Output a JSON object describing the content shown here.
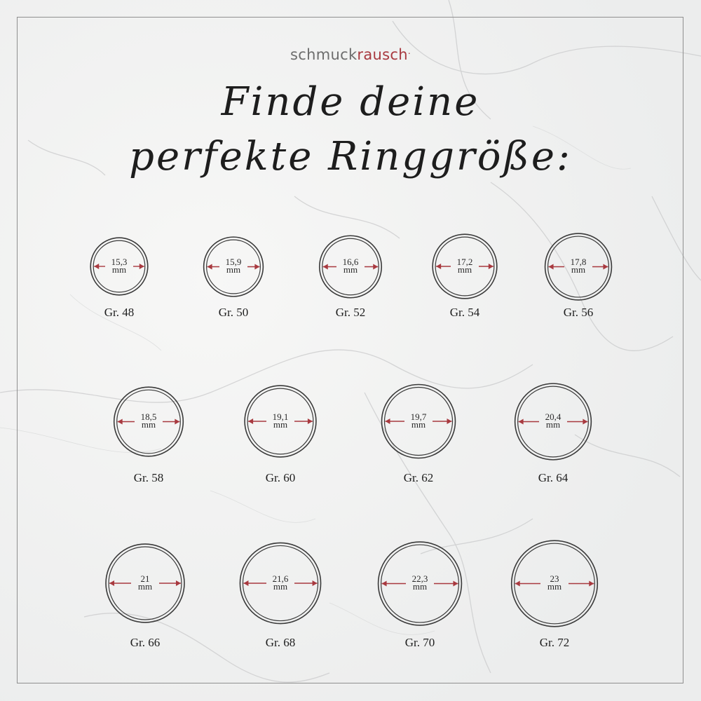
{
  "brand": {
    "part1": "schmuck",
    "part2": "rausch",
    "mark": "."
  },
  "title": {
    "line1": "Finde deine",
    "line2": "perfekte Ringgröße:"
  },
  "colors": {
    "background": "#f2f2f1",
    "ring": "#3a3a3a",
    "arrow": "#a8393f",
    "brand_accent": "#a8393f"
  },
  "unit": "mm",
  "rings": [
    {
      "size_label": "Gr. 48",
      "diameter": "15,3"
    },
    {
      "size_label": "Gr. 50",
      "diameter": "15,9"
    },
    {
      "size_label": "Gr. 52",
      "diameter": "16,6"
    },
    {
      "size_label": "Gr. 54",
      "diameter": "17,2"
    },
    {
      "size_label": "Gr. 56",
      "diameter": "17,8"
    },
    {
      "size_label": "Gr. 58",
      "diameter": "18,5"
    },
    {
      "size_label": "Gr. 60",
      "diameter": "19,1"
    },
    {
      "size_label": "Gr. 62",
      "diameter": "19,7"
    },
    {
      "size_label": "Gr. 64",
      "diameter": "20,4"
    },
    {
      "size_label": "Gr. 66",
      "diameter": "21"
    },
    {
      "size_label": "Gr. 68",
      "diameter": "21,6"
    },
    {
      "size_label": "Gr. 70",
      "diameter": "22,3"
    },
    {
      "size_label": "Gr. 72",
      "diameter": "23"
    }
  ]
}
